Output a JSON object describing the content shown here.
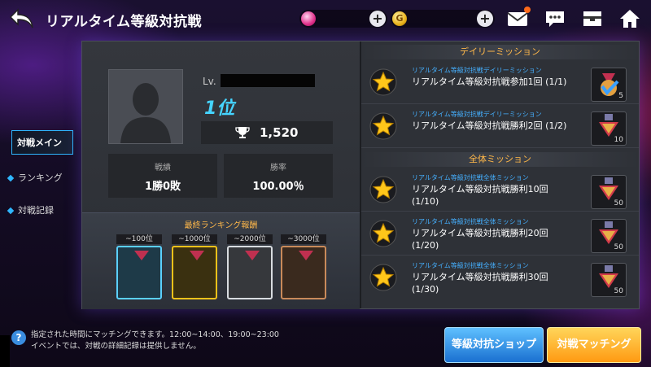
{
  "header": {
    "title": "リアルタイム等級対抗戦"
  },
  "currency": {
    "gold_symbol": "G"
  },
  "sidebar": {
    "tabs": [
      {
        "label": "対戦メイン",
        "active": true
      },
      {
        "label": "ランキング",
        "active": false
      },
      {
        "label": "対戦記録",
        "active": false
      }
    ]
  },
  "profile": {
    "level_label": "Lv.",
    "rank": "1位",
    "score": "1,520",
    "stats": {
      "record_label": "戦績",
      "record_value": "1勝0敗",
      "winrate_label": "勝率",
      "winrate_value": "100.00％"
    }
  },
  "rewards": {
    "title": "最終ランキング報酬",
    "items": [
      {
        "label": "~100位",
        "color": "#5ad0ff"
      },
      {
        "label": "~1000位",
        "color": "#f5c21a"
      },
      {
        "label": "~2000位",
        "color": "#d8dce0"
      },
      {
        "label": "~3000位",
        "color": "#c98a5a"
      }
    ]
  },
  "daily": {
    "title": "デイリーミッション",
    "missions": [
      {
        "category": "リアルタイム等級対抗戦デイリーミッション",
        "text": "リアルタイム等級対抗戦参加1回 (1/1)",
        "count": "5",
        "completed": true
      },
      {
        "category": "リアルタイム等級対抗戦デイリーミッション",
        "text": "リアルタイム等級対抗戦勝利2回 (1/2)",
        "count": "10",
        "completed": false
      }
    ]
  },
  "overall": {
    "title": "全体ミッション",
    "missions": [
      {
        "category": "リアルタイム等級対抗戦全体ミッション",
        "text": "リアルタイム等級対抗戦勝利10回 (1/10)",
        "count": "50"
      },
      {
        "category": "リアルタイム等級対抗戦全体ミッション",
        "text": "リアルタイム等級対抗戦勝利20回 (1/20)",
        "count": "50"
      },
      {
        "category": "リアルタイム等級対抗戦全体ミッション",
        "text": "リアルタイム等級対抗戦勝利30回 (1/30)",
        "count": "50"
      }
    ]
  },
  "footer": {
    "notice_line1": "指定された時間にマッチングできます。12:00~14:00、19:00~23:00",
    "notice_line2": "イベントでは、対戦の詳細記録は提供しません。",
    "shop_button": "等級対抗ショップ",
    "match_button": "対戦マッチング"
  }
}
